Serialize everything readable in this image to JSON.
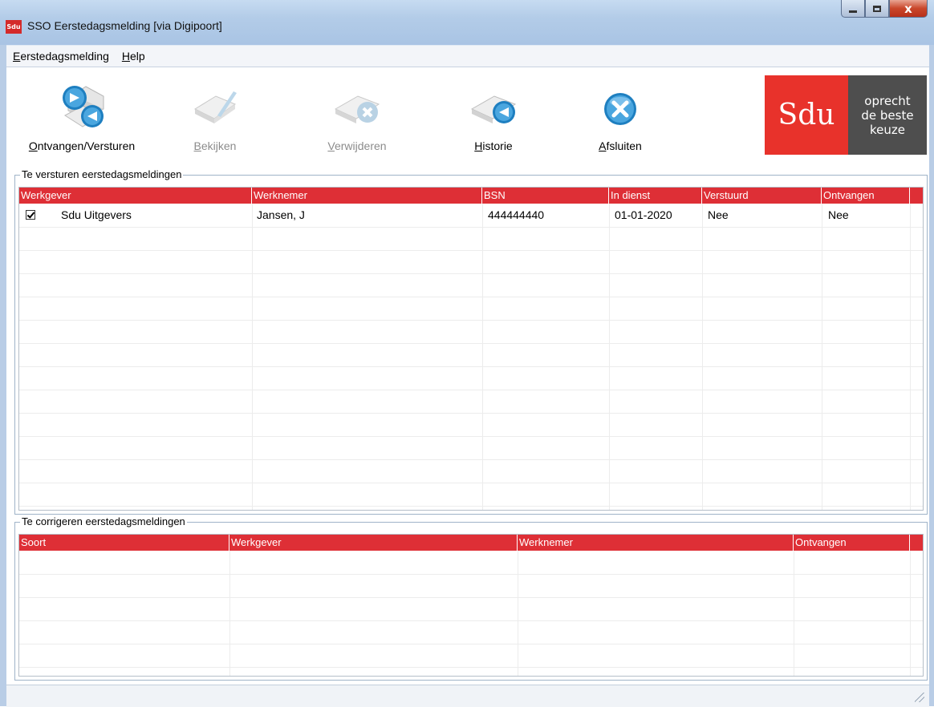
{
  "window": {
    "icon_text": "Sdu",
    "title": "SSO Eerstedagsmelding [via Digipoort]",
    "close_glyph": "x"
  },
  "menu": {
    "items": [
      {
        "accel": "E",
        "rest": "erstedagsmelding"
      },
      {
        "accel": "H",
        "rest": "elp"
      }
    ]
  },
  "toolbar": {
    "buttons": [
      {
        "accel": "O",
        "rest": "ntvangen/Versturen",
        "icon": "send-receive-icon",
        "enabled": true
      },
      {
        "accel": "B",
        "rest": "ekijken",
        "icon": "view-icon",
        "enabled": false
      },
      {
        "accel": "V",
        "rest": "erwijderen",
        "icon": "delete-icon",
        "enabled": false
      },
      {
        "accel": "H",
        "rest": "istorie",
        "icon": "history-icon",
        "enabled": true
      },
      {
        "accel": "A",
        "rest": "fsluiten",
        "icon": "close-app-icon",
        "enabled": true
      }
    ]
  },
  "logo": {
    "brand": "Sdu",
    "tagline_1": "oprecht",
    "tagline_2": "de beste",
    "tagline_3": "keuze"
  },
  "send_group": {
    "legend": "Te versturen eerstedagsmeldingen",
    "columns": [
      "Werkgever",
      "Werknemer",
      "BSN",
      "In dienst",
      "Verstuurd",
      "Ontvangen"
    ],
    "rows": [
      {
        "checked": true,
        "werkgever": "Sdu Uitgevers",
        "werknemer": "Jansen, J",
        "bsn": "444444440",
        "in_dienst": "01-01-2020",
        "verstuurd": "Nee",
        "ontvangen": "Nee"
      }
    ]
  },
  "correct_group": {
    "legend": "Te corrigeren eerstedagsmeldingen",
    "columns": [
      "Soort",
      "Werkgever",
      "Werknemer",
      "Ontvangen"
    ]
  },
  "colors": {
    "header_red": "#de2f36",
    "sdu_red": "#e8322b",
    "sdu_gray": "#4e4e4e"
  }
}
